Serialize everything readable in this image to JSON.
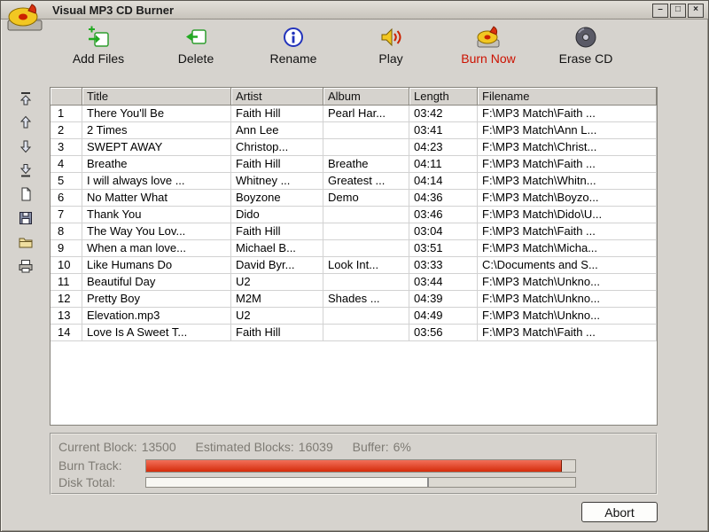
{
  "window": {
    "title": "Visual MP3 CD Burner",
    "controls": {
      "minimize": "–",
      "maximize": "□",
      "close": "×"
    }
  },
  "toolbar": {
    "buttons": [
      {
        "label": "Add Files"
      },
      {
        "label": "Delete"
      },
      {
        "label": "Rename"
      },
      {
        "label": "Play"
      },
      {
        "label": "Burn Now"
      },
      {
        "label": "Erase CD"
      }
    ]
  },
  "table": {
    "headers": {
      "num": "",
      "title": "Title",
      "artist": "Artist",
      "album": "Album",
      "length": "Length",
      "filename": "Filename"
    },
    "rows": [
      {
        "num": "1",
        "title": "There You'll Be",
        "artist": "Faith Hill",
        "album": "Pearl Har...",
        "length": "03:42",
        "filename": "F:\\MP3 Match\\Faith ..."
      },
      {
        "num": "2",
        "title": "2 Times",
        "artist": "Ann Lee",
        "album": "",
        "length": "03:41",
        "filename": "F:\\MP3 Match\\Ann L..."
      },
      {
        "num": "3",
        "title": "SWEPT AWAY",
        "artist": "Christop...",
        "album": "",
        "length": "04:23",
        "filename": "F:\\MP3 Match\\Christ..."
      },
      {
        "num": "4",
        "title": "Breathe",
        "artist": "Faith Hill",
        "album": "Breathe",
        "length": "04:11",
        "filename": "F:\\MP3 Match\\Faith ..."
      },
      {
        "num": "5",
        "title": "I will always love ...",
        "artist": "Whitney ...",
        "album": "Greatest ...",
        "length": "04:14",
        "filename": "F:\\MP3 Match\\Whitn..."
      },
      {
        "num": "6",
        "title": "No Matter What",
        "artist": "Boyzone",
        "album": "Demo",
        "length": "04:36",
        "filename": "F:\\MP3 Match\\Boyzo..."
      },
      {
        "num": "7",
        "title": "Thank You",
        "artist": "Dido",
        "album": "",
        "length": "03:46",
        "filename": "F:\\MP3 Match\\Dido\\U..."
      },
      {
        "num": "8",
        "title": "The Way You Lov...",
        "artist": "Faith Hill",
        "album": "",
        "length": "03:04",
        "filename": "F:\\MP3 Match\\Faith ..."
      },
      {
        "num": "9",
        "title": "When a man love...",
        "artist": "Michael B...",
        "album": "",
        "length": "03:51",
        "filename": "F:\\MP3 Match\\Micha..."
      },
      {
        "num": "10",
        "title": "Like Humans Do",
        "artist": "David Byr...",
        "album": "Look Int...",
        "length": "03:33",
        "filename": "C:\\Documents and S..."
      },
      {
        "num": "11",
        "title": "Beautiful Day",
        "artist": "U2",
        "album": "",
        "length": "03:44",
        "filename": "F:\\MP3 Match\\Unkno..."
      },
      {
        "num": "12",
        "title": "Pretty Boy",
        "artist": "M2M",
        "album": "Shades ...",
        "length": "04:39",
        "filename": "F:\\MP3 Match\\Unkno..."
      },
      {
        "num": "13",
        "title": "Elevation.mp3",
        "artist": "U2",
        "album": "",
        "length": "04:49",
        "filename": "F:\\MP3 Match\\Unkno..."
      },
      {
        "num": "14",
        "title": "Love Is A Sweet T...",
        "artist": "Faith Hill",
        "album": "",
        "length": "03:56",
        "filename": "F:\\MP3 Match\\Faith ..."
      }
    ]
  },
  "status": {
    "current_block_label": "Current Block:",
    "current_block_value": "13500",
    "estimated_blocks_label": "Estimated Blocks:",
    "estimated_blocks_value": "16039",
    "buffer_label": "Buffer:",
    "buffer_value": "6%",
    "burn_track_label": "Burn Track:",
    "burn_track_percent": 97,
    "disk_total_label": "Disk Total:",
    "disk_total_percent": 66
  },
  "abort_label": "Abort",
  "colors": {
    "burn_now_text": "#cc1100",
    "burn_bar": "#d42b0a",
    "burn_bar_light": "#f2705a",
    "window_bg": "#d6d3ce"
  }
}
